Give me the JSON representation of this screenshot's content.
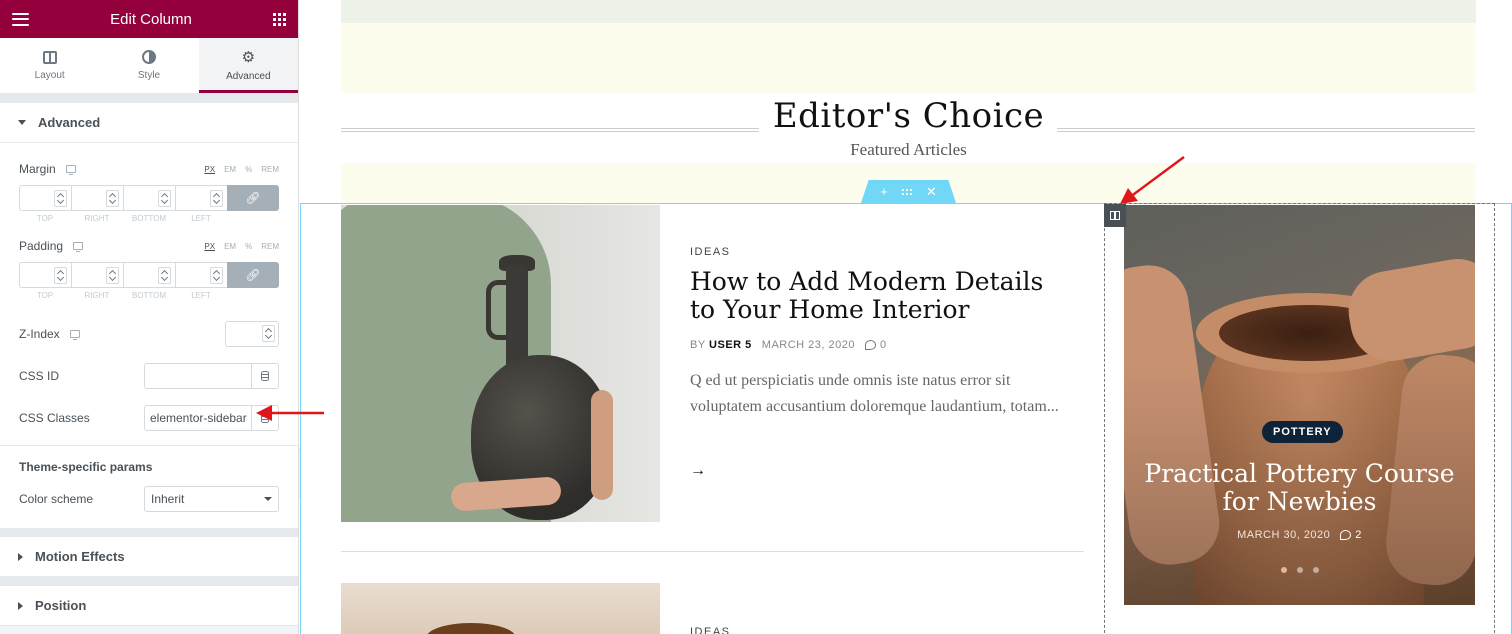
{
  "panel": {
    "title": "Edit Column",
    "tabs": [
      {
        "label": "Layout",
        "icon": "layout-icon"
      },
      {
        "label": "Style",
        "icon": "style-icon"
      },
      {
        "label": "Advanced",
        "icon": "gear-icon"
      }
    ],
    "active_tab": "Advanced",
    "advanced": {
      "heading": "Advanced",
      "margin": {
        "label": "Margin",
        "units": [
          "PX",
          "EM",
          "%",
          "REM"
        ],
        "active_unit": "PX",
        "sides": [
          "TOP",
          "RIGHT",
          "BOTTOM",
          "LEFT"
        ]
      },
      "padding": {
        "label": "Padding",
        "units": [
          "PX",
          "EM",
          "%",
          "REM"
        ],
        "active_unit": "PX",
        "sides": [
          "TOP",
          "RIGHT",
          "BOTTOM",
          "LEFT"
        ]
      },
      "z_index": {
        "label": "Z-Index"
      },
      "css_id": {
        "label": "CSS ID",
        "value": ""
      },
      "css_classes": {
        "label": "CSS Classes",
        "value": "elementor-sidebar"
      }
    },
    "theme_params": {
      "heading": "Theme-specific params",
      "color_scheme": {
        "label": "Color scheme",
        "value": "Inherit"
      }
    },
    "collapsed_sections": [
      "Motion Effects",
      "Position"
    ]
  },
  "preview": {
    "heading": "Editor's Choice",
    "subheading": "Featured Articles",
    "posts": [
      {
        "category": "IDEAS",
        "title": "How to Add Modern Details to Your Home Interior",
        "by": "BY",
        "author": "USER 5",
        "date": "MARCH 23, 2020",
        "comments": "0",
        "excerpt": "Q ed ut perspiciatis unde omnis iste natus error sit voluptatem accusantium doloremque laudantium, totam...",
        "arrow": "→"
      },
      {
        "category": "IDEAS"
      }
    ],
    "featured": {
      "badge": "POTTERY",
      "title": "Practical Pottery Course for Newbies",
      "date": "MARCH 30, 2020",
      "comments": "2",
      "slides": 3,
      "active_slide": 0
    }
  },
  "colors": {
    "brand": "#93003c",
    "section_outline": "#71d7f7",
    "annotation_arrow": "#e0161b",
    "badge_bg": "#0f2338"
  }
}
